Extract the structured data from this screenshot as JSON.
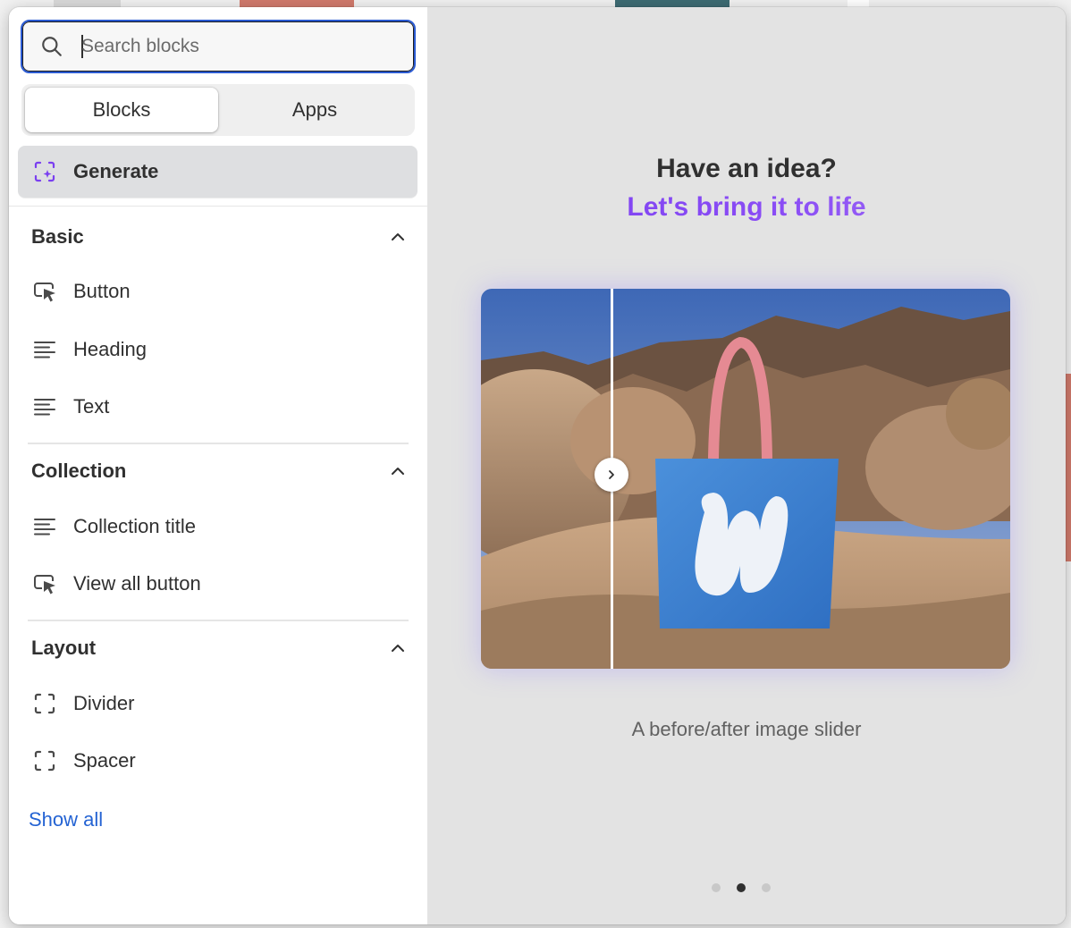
{
  "search": {
    "placeholder": "Search blocks",
    "value": ""
  },
  "tabs": [
    {
      "label": "Blocks",
      "active": true
    },
    {
      "label": "Apps",
      "active": false
    }
  ],
  "generate": {
    "label": "Generate",
    "icon": "sparkle-frame-icon"
  },
  "sections": [
    {
      "title": "Basic",
      "expanded": true,
      "items": [
        {
          "label": "Button",
          "icon": "cursor-button-icon"
        },
        {
          "label": "Heading",
          "icon": "text-lines-icon"
        },
        {
          "label": "Text",
          "icon": "text-lines-icon"
        }
      ]
    },
    {
      "title": "Collection",
      "expanded": true,
      "items": [
        {
          "label": "Collection title",
          "icon": "text-lines-icon"
        },
        {
          "label": "View all button",
          "icon": "cursor-button-icon"
        }
      ]
    },
    {
      "title": "Layout",
      "expanded": true,
      "items": [
        {
          "label": "Divider",
          "icon": "dashed-frame-icon"
        },
        {
          "label": "Spacer",
          "icon": "dashed-frame-icon"
        }
      ]
    }
  ],
  "show_all": "Show all",
  "promo": {
    "title": "Have an idea?",
    "subtitle": "Let's bring it to life",
    "caption": "A before/after image slider",
    "carousel_total": 3,
    "carousel_active": 2
  },
  "colors": {
    "accent_purple": "#7a3ff0",
    "link_blue": "#2463d3",
    "focus_blue": "#2a5ad2"
  }
}
